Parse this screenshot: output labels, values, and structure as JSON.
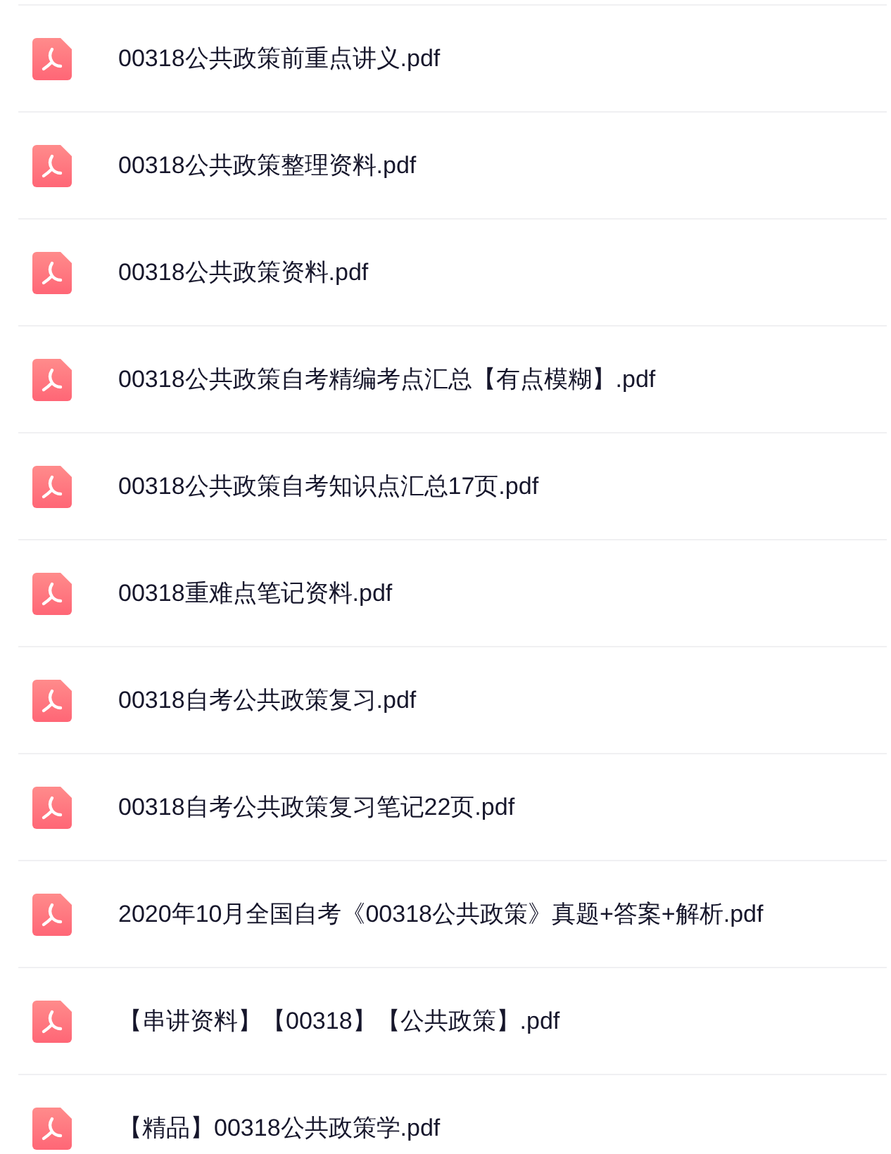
{
  "files": [
    {
      "name": "00318公共政策前重点讲义.pdf"
    },
    {
      "name": "00318公共政策整理资料.pdf"
    },
    {
      "name": "00318公共政策资料.pdf"
    },
    {
      "name": "00318公共政策自考精编考点汇总【有点模糊】.pdf"
    },
    {
      "name": "00318公共政策自考知识点汇总17页.pdf"
    },
    {
      "name": "00318重难点笔记资料.pdf"
    },
    {
      "name": "00318自考公共政策复习.pdf"
    },
    {
      "name": "00318自考公共政策复习笔记22页.pdf"
    },
    {
      "name": "2020年10月全国自考《00318公共政策》真题+答案+解析.pdf"
    },
    {
      "name": "【串讲资料】【00318】【公共政策】.pdf"
    },
    {
      "name": "【精品】00318公共政策学.pdf"
    }
  ]
}
